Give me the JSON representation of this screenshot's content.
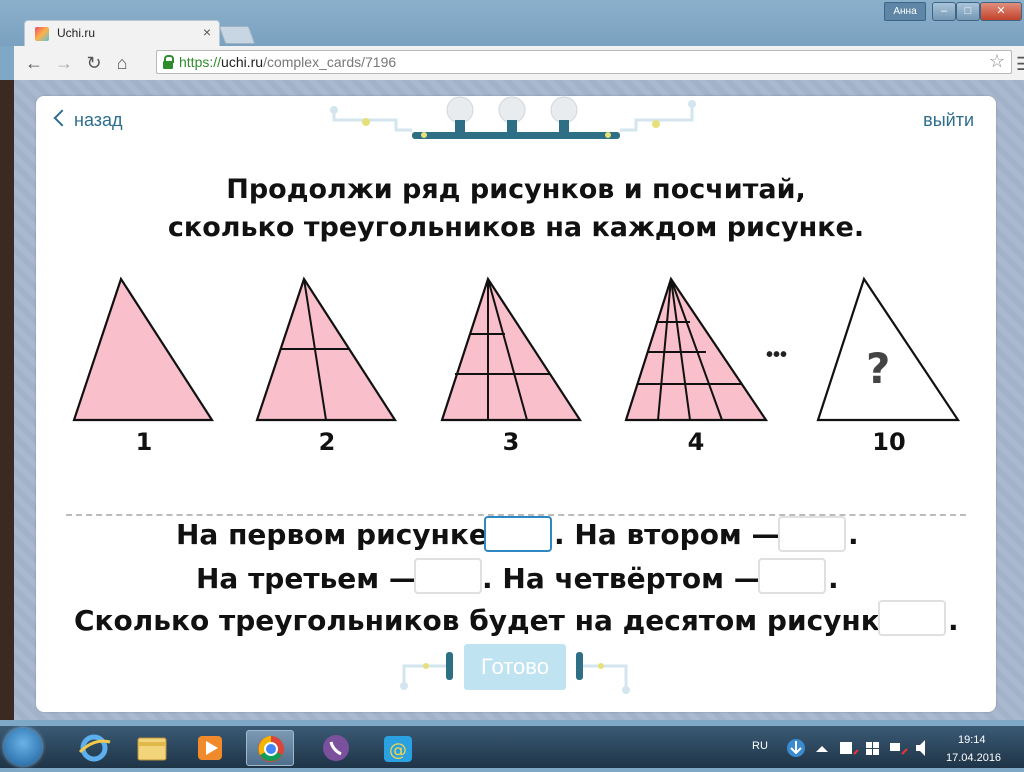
{
  "browser": {
    "user_label": "Анна",
    "tab_title": "Uchi.ru",
    "tab_close": "×",
    "url_scheme": "https://",
    "url_host": "uchi.ru",
    "url_path": "/complex_cards/7196",
    "menu_icon": "☰",
    "star_icon": "☆"
  },
  "card": {
    "back_label": "назад",
    "exit_label": "выйти",
    "question_line1": "Продолжи ряд рисунков и посчитай,",
    "question_line2": "сколько треугольников на каждом рисунке.",
    "figure_labels": [
      "1",
      "2",
      "3",
      "4",
      "10"
    ],
    "ellipsis": "•••",
    "unknown": "?",
    "answer_line1_a": "На первом рисунке",
    "answer_line1_b": ". На втором —",
    "answer_line1_end": ".",
    "answer_line2_a": "На третьем —",
    "answer_line2_b": ". На четвёртом —",
    "answer_line2_end": ".",
    "answer_line3_a": "Сколько треугольников будет на десятом рисунке?",
    "answer_line3_end": ".",
    "ready_label": "Готово",
    "triangle_fill": "#f9bfcb",
    "accent": "#2d6e8f"
  },
  "taskbar": {
    "lang": "RU",
    "time": "19:14",
    "date": "17.04.2016"
  }
}
